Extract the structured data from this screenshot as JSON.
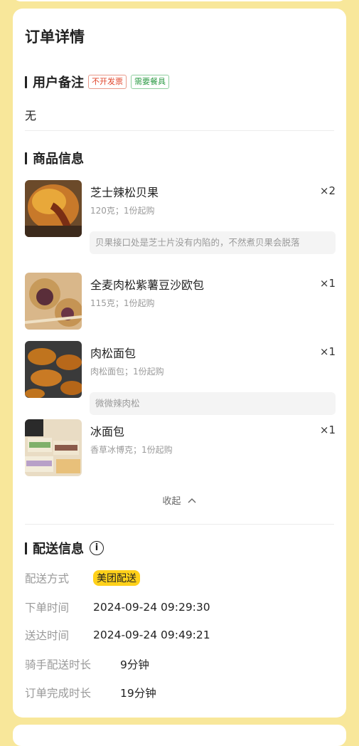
{
  "order_detail": {
    "title": "订单详情"
  },
  "remark": {
    "heading": "用户备注",
    "tags": [
      {
        "label": "不开发票",
        "color": "#e0452b"
      },
      {
        "label": "需要餐具",
        "color": "#2e9b46"
      }
    ],
    "text": "无"
  },
  "products": {
    "heading": "商品信息",
    "items": [
      {
        "name": "芝士辣松贝果",
        "qty": "×2",
        "spec": "120克；1份起购",
        "note": "贝果接口处是芝士片没有内陷的，不然煮贝果会脱落",
        "image_icon": "bagel-photo"
      },
      {
        "name": "全麦肉松紫薯豆沙欧包",
        "qty": "×1",
        "spec": "115克；1份起购",
        "note": "",
        "image_icon": "bread-photo"
      },
      {
        "name": "肉松面包",
        "qty": "×1",
        "spec": "肉松面包；1份起购",
        "note": "微微辣肉松",
        "image_icon": "floss-bread-photo"
      },
      {
        "name": "冰面包",
        "qty": "×1",
        "spec": "香草冰博克；1份起购",
        "note": "",
        "image_icon": "ice-bread-photo"
      }
    ],
    "collapse_label": "收起"
  },
  "delivery": {
    "heading": "配送信息",
    "method_label": "配送方式",
    "method_value": "美团配送",
    "order_time_label": "下单时间",
    "order_time": "2024-09-24 09:29:30",
    "arrive_time_label": "送达时间",
    "arrive_time": "2024-09-24 09:49:21",
    "rider_duration_label": "骑手配送时长",
    "rider_duration": "9分钟",
    "complete_duration_label": "订单完成时长",
    "complete_duration": "19分钟",
    "accent": "#ffd11a"
  }
}
